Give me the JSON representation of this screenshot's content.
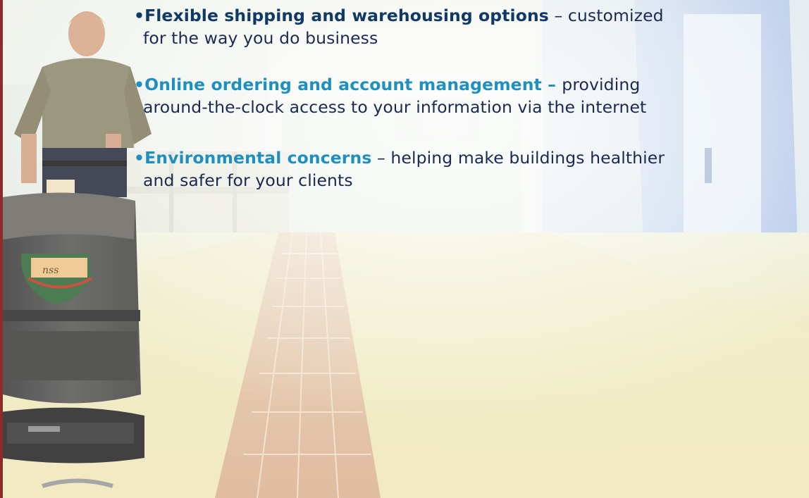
{
  "logo_text": "nss",
  "colors": {
    "heading_dark": "#0f3a66",
    "heading_blue": "#1f8fbe",
    "body_text": "#1a2a52",
    "border_red": "#8f2a2a"
  },
  "bullets": [
    {
      "marker": "•",
      "heading": "Flexible shipping and warehousing options",
      "separator": " – ",
      "text_line1": "customized",
      "text_line2": "for the way you do business"
    },
    {
      "marker": "•",
      "heading": "Online ordering and account management",
      "separator": " – ",
      "text_line1": "providing",
      "text_line2": "around-the-clock access to your information via the internet"
    },
    {
      "marker": "•",
      "heading": "Environmental concerns",
      "separator": " – ",
      "text_line1": "helping make buildings healthier",
      "text_line2": "and safer for your clients"
    }
  ]
}
